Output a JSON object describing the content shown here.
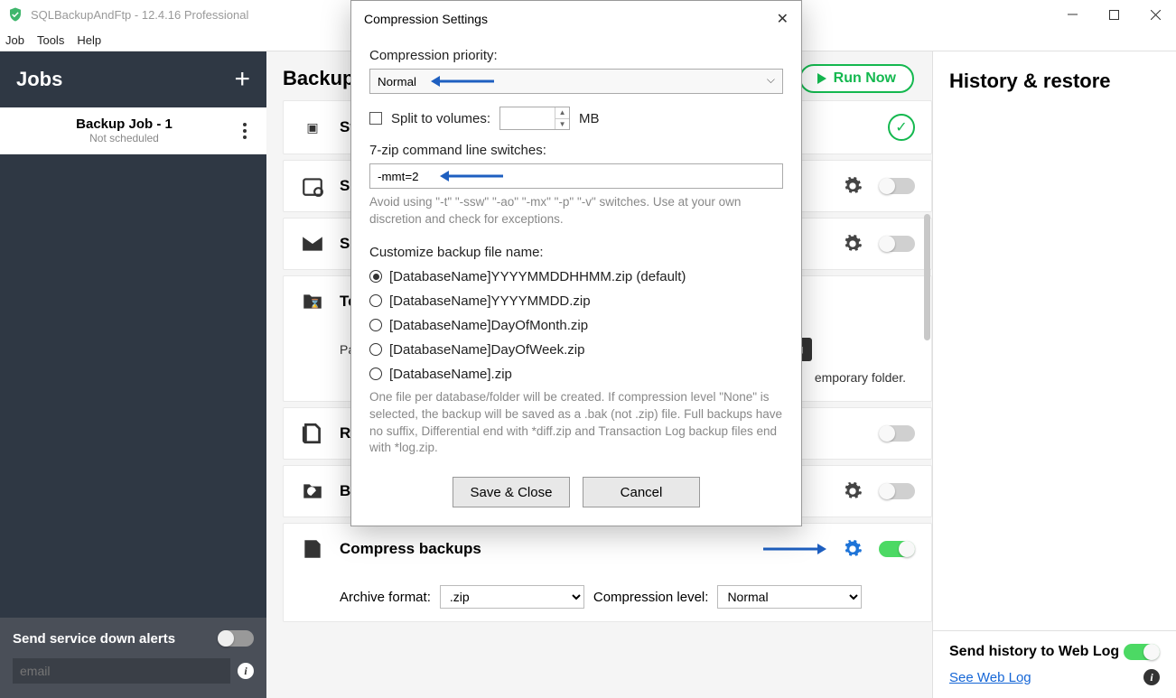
{
  "window": {
    "title": "SQLBackupAndFtp - 12.4.16 Professional"
  },
  "menu": {
    "job": "Job",
    "tools": "Tools",
    "help": "Help"
  },
  "sidebar": {
    "title": "Jobs",
    "job_name": "Backup Job - 1",
    "job_sub": "Not scheduled",
    "service_label": "Send service down alerts",
    "email_placeholder": "email"
  },
  "mid": {
    "title": "Backup",
    "run": "Run Now",
    "rows": {
      "st": "St",
      "sc": "Sc",
      "se": "Se",
      "te": "Te",
      "te_path_label": "Pat",
      "te_note": "emporary folder.",
      "ru": "Ru",
      "ba": "Ba"
    },
    "compress": {
      "label": "Compress backups",
      "archive_label": "Archive format:",
      "archive_value": ".zip",
      "level_label": "Compression level:",
      "level_value": "Normal"
    }
  },
  "right": {
    "title": "History & restore",
    "send_label": "Send history to Web Log",
    "link": "See Web Log"
  },
  "dialog": {
    "title": "Compression Settings",
    "priority_label": "Compression priority:",
    "priority_value": "Normal",
    "split_label": "Split to volumes:",
    "split_unit": "MB",
    "zip_label": "7-zip command line switches:",
    "zip_value": "-mmt=2",
    "zip_hint": "Avoid using \"-t\" \"-ssw\" \"-ao\" \"-mx\" \"-p\" \"-v\" switches. Use at your own discretion and check for exceptions.",
    "custom_label": "Customize backup file name:",
    "radios": [
      "[DatabaseName]YYYYMMDDHHMM.zip (default)",
      "[DatabaseName]YYYYMMDD.zip",
      "[DatabaseName]DayOfMonth.zip",
      "[DatabaseName]DayOfWeek.zip",
      "[DatabaseName].zip"
    ],
    "radio_hint": "One file per database/folder will be created. If compression level \"None\" is selected, the backup will be saved as a .bak (not .zip) file. Full backups have no suffix, Differential end with *diff.zip and Transaction Log backup files end with *log.zip.",
    "save": "Save & Close",
    "cancel": "Cancel"
  }
}
